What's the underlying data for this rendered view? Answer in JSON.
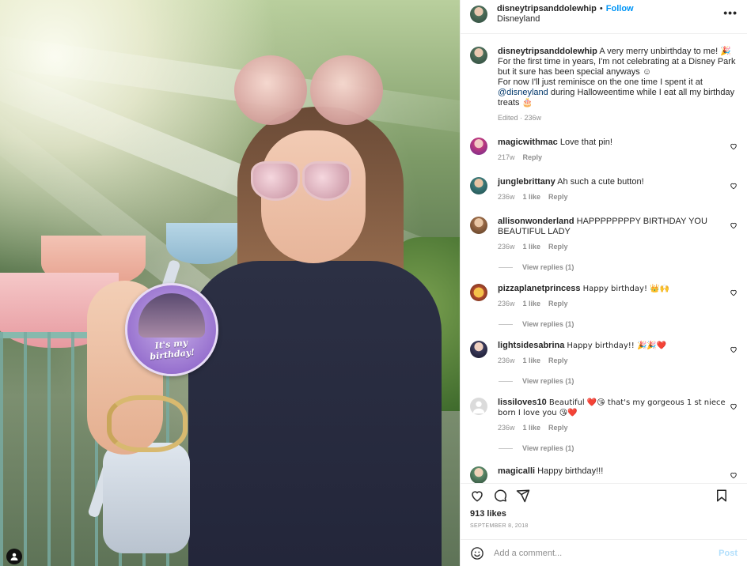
{
  "post": {
    "username": "disneytripsanddolewhip",
    "location": "Disneyland",
    "follow_label": "Follow",
    "separator": "•",
    "more_label": "•••",
    "pin_text": "It's my birthday!"
  },
  "caption": {
    "username": "disneytripsanddolewhip",
    "line1": "A very merry unbirthday to me! 🎉",
    "line2": "For the first time in years, I'm not celebrating at a Disney Park but it sure has been special anyways ☺",
    "line3_pre": "For now I'll just reminisce on the one time I spent it at ",
    "mention": "@disneyland",
    "line3_post": " during Halloweentime while I eat all my birthday treats 🎂",
    "meta": "Edited · 236w"
  },
  "comments": [
    {
      "username": "magicwithmac",
      "text": "Love that pin!",
      "time": "217w",
      "likes": "",
      "reply": "Reply",
      "views": ""
    },
    {
      "username": "junglebrittany",
      "text": "Ah such a cute button!",
      "time": "236w",
      "likes": "1 like",
      "reply": "Reply",
      "views": ""
    },
    {
      "username": "allisonwonderland",
      "text": "HAPPPPPPPPY BIRTHDAY YOU BEAUTIFUL LADY",
      "time": "236w",
      "likes": "1 like",
      "reply": "Reply",
      "views": "View replies (1)"
    },
    {
      "username": "pizzaplanetprincess",
      "text": "Happy birthday! 👑🙌",
      "time": "236w",
      "likes": "1 like",
      "reply": "Reply",
      "views": "View replies (1)"
    },
    {
      "username": "lightsidesabrina",
      "text": "Happy birthday!! 🎉🎉❤️",
      "time": "236w",
      "likes": "1 like",
      "reply": "Reply",
      "views": "View replies (1)"
    },
    {
      "username": "lissiloves10",
      "text": "Beautiful ❤️😘 that's my gorgeous 1 st niece born I love you 😘❤️",
      "time": "236w",
      "likes": "1 like",
      "reply": "Reply",
      "views": "View replies (1)"
    },
    {
      "username": "magicalli",
      "text": "Happy birthday!!!",
      "time": "",
      "likes": "",
      "reply": "",
      "views": ""
    }
  ],
  "engagement": {
    "likes": "913 likes",
    "date": "SEPTEMBER 8, 2018"
  },
  "add_comment": {
    "placeholder": "Add a comment...",
    "post_label": "Post"
  },
  "colors": {
    "follow": "#0095f6",
    "meta": "#8e8e8e",
    "post_disabled": "#b2dffc",
    "heart_red": "#ed4956"
  }
}
